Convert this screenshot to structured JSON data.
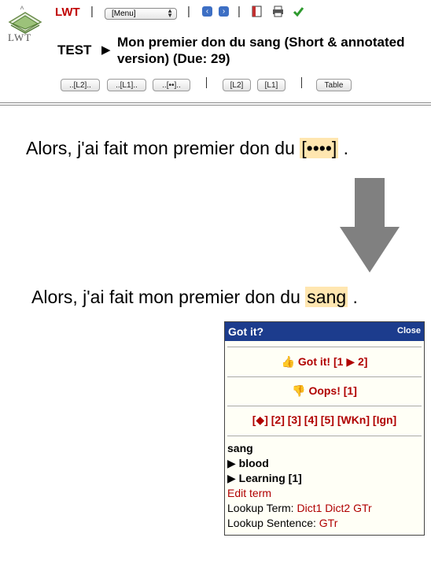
{
  "header": {
    "logo_text": "LWT",
    "app_name": "LWT",
    "menu_select": "[Menu]",
    "test_label": "TEST",
    "title": "Mon premier don du sang (Short & annotated version) (Due: 29)",
    "test_buttons": [
      "..[L2]..",
      "..[L1]..",
      "..[••]..",
      "[L2]",
      "[L1]",
      "Table"
    ]
  },
  "sentence_before": {
    "text": "Alors, j'ai fait mon premier don du",
    "blank": "[••••]",
    "end": "."
  },
  "sentence_after": {
    "text": "Alors, j'ai fait mon premier don du",
    "word": "sang",
    "end": "."
  },
  "popup": {
    "title": "Got it?",
    "close": "Close",
    "got_it": "Got it! [1 ▶ 2]",
    "oops": "Oops! [1]",
    "status_options": [
      "[◆]",
      "[2]",
      "[3]",
      "[4]",
      "[5]",
      "[WKn]",
      "[Ign]"
    ],
    "term": "sang",
    "translation": "▶ blood",
    "learning": "▶ Learning [1]",
    "edit_term": "Edit term",
    "lookup_term_label": "Lookup Term:",
    "lookup_term_links": [
      "Dict1",
      "Dict2",
      "GTr"
    ],
    "lookup_sentence_label": "Lookup Sentence:",
    "lookup_sentence_links": [
      "GTr"
    ]
  },
  "colors": {
    "brand_red": "#c00000",
    "popup_header": "#1c3c8d",
    "highlight": "#ffe6b0",
    "arrow_gray": "#808080"
  }
}
